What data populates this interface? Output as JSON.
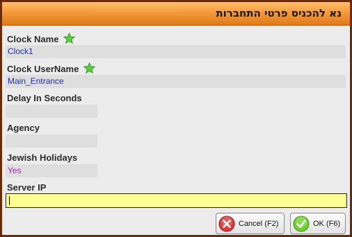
{
  "window": {
    "title": "נא להכניס פרטי התחברות"
  },
  "fields": {
    "clock_name": {
      "label": "Clock Name",
      "value": "Clock1"
    },
    "clock_username": {
      "label": "Clock UserName",
      "value": "Main_Entrance"
    },
    "delay": {
      "label": "Delay In Seconds",
      "value": ""
    },
    "agency": {
      "label": "Agency",
      "value": ""
    },
    "jewish_holidays": {
      "label": "Jewish Holidays",
      "value": "Yes"
    },
    "server_ip": {
      "label": "Server IP",
      "value": ""
    }
  },
  "buttons": {
    "cancel": "Cancel (F2)",
    "ok": "OK (F6)"
  },
  "icons": {
    "required": "green-star-icon",
    "cancel": "red-x-circle-icon",
    "ok": "green-check-circle-icon"
  },
  "colors": {
    "title_bar": "#f59a3c",
    "frame": "#6b2a08",
    "value_text": "#1f2fb5",
    "yes_text": "#b020b8",
    "active_input": "#ffff94"
  }
}
